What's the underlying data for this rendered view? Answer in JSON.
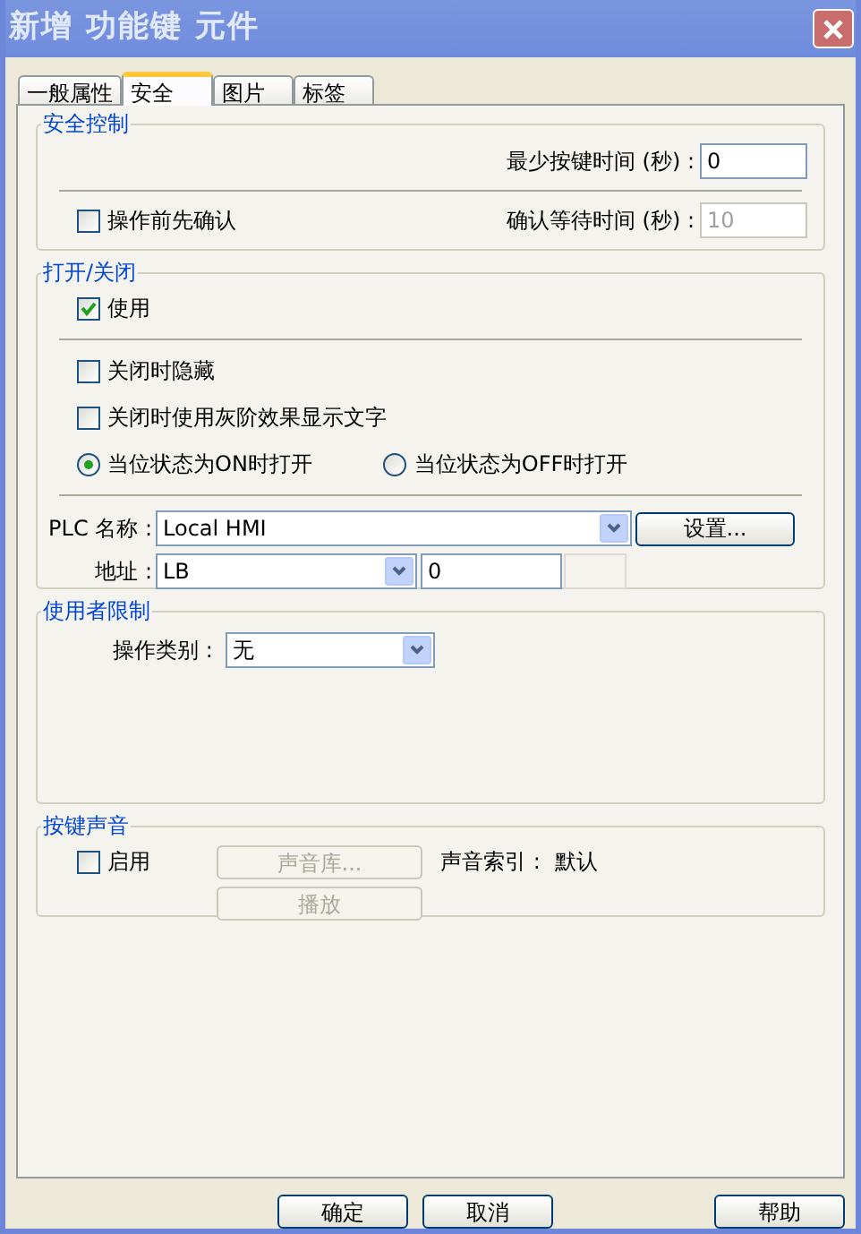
{
  "window": {
    "title": "新增 功能键 元件"
  },
  "tabs": [
    {
      "label": "一般属性",
      "selected": false
    },
    {
      "label": "安全",
      "selected": true
    },
    {
      "label": "图片",
      "selected": false
    },
    {
      "label": "标签",
      "selected": false
    }
  ],
  "security": {
    "title": "安全控制",
    "min_press_label": "最少按键时间 (秒) :",
    "min_press_value": "0",
    "confirm": {
      "label": "操作前先确认",
      "checked": false
    },
    "wait_label": "确认等待时间 (秒) :",
    "wait_value": "10",
    "wait_disabled": true
  },
  "open_close": {
    "title": "打开/关闭",
    "enable": {
      "label": "使用",
      "checked": true
    },
    "options": [
      {
        "label": "关闭时隐藏",
        "checked": false
      },
      {
        "label": "关闭时使用灰阶效果显示文字",
        "checked": false
      }
    ],
    "radios": [
      {
        "label": "当位状态为ON时打开",
        "selected": true
      },
      {
        "label": "当位状态为OFF时打开",
        "selected": false
      }
    ],
    "plc": {
      "label": "PLC 名称 :",
      "value": "Local HMI",
      "button": "设置..."
    },
    "address": {
      "label": "地址 :",
      "device": "LB",
      "value": "0"
    }
  },
  "user_restriction": {
    "title": "使用者限制",
    "category_label": "操作类别 :",
    "category_value": "无"
  },
  "sound": {
    "title": "按键声音",
    "enable": {
      "label": "启用",
      "checked": false
    },
    "library_button": {
      "label": "声音库...",
      "disabled": true
    },
    "index_label": "声音索引 :",
    "index_value": "默认",
    "play_button": {
      "label": "播放",
      "disabled": true
    }
  },
  "buttons": [
    {
      "label": "确定"
    },
    {
      "label": "取消"
    }
  ],
  "help_button": {
    "label": "帮助"
  }
}
